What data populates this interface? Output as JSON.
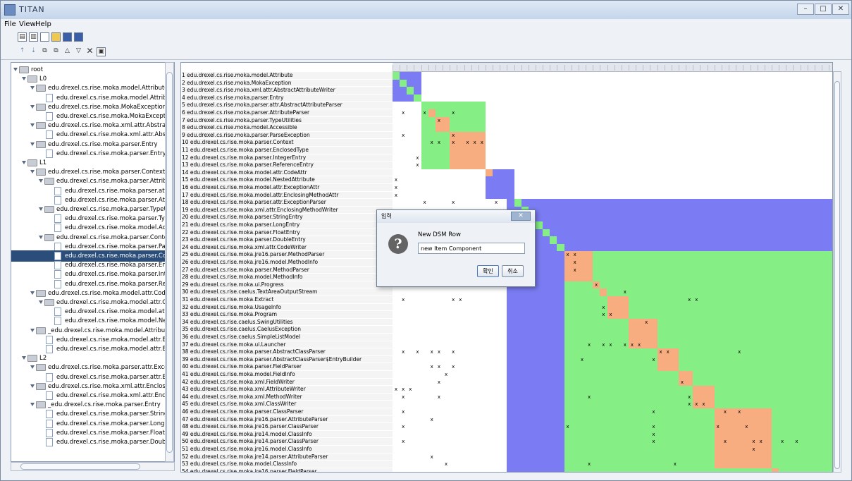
{
  "window": {
    "title": "TITAN",
    "controls": [
      "–",
      "□",
      "✕"
    ]
  },
  "menu": [
    "File",
    "View",
    "Help"
  ],
  "colors": {
    "blue": "#7b7cf3",
    "green": "#85ee84",
    "orange": "#f7ad80",
    "selected": "#2a4d79"
  },
  "tree": [
    {
      "label": "root",
      "kind": "folder",
      "depth": 0,
      "expanded": true
    },
    {
      "label": "L0",
      "kind": "folder",
      "depth": 1,
      "expanded": true
    },
    {
      "label": "edu.drexel.cs.rise.moka.model.Attribute",
      "kind": "folder",
      "depth": 2,
      "expanded": true
    },
    {
      "label": "edu.drexel.cs.rise.moka.model.Attribute",
      "kind": "file",
      "depth": 3
    },
    {
      "label": "edu.drexel.cs.rise.moka.MokaException",
      "kind": "folder",
      "depth": 2,
      "expanded": true
    },
    {
      "label": "edu.drexel.cs.rise.moka.MokaException",
      "kind": "file",
      "depth": 3
    },
    {
      "label": "edu.drexel.cs.rise.moka.xml.attr.AbstractAttribute",
      "kind": "folder",
      "depth": 2,
      "expanded": true
    },
    {
      "label": "edu.drexel.cs.rise.moka.xml.attr.AbstractAttrib",
      "kind": "file",
      "depth": 3
    },
    {
      "label": "edu.drexel.cs.rise.moka.parser.Entry",
      "kind": "folder",
      "depth": 2,
      "expanded": true
    },
    {
      "label": "edu.drexel.cs.rise.moka.parser.Entry",
      "kind": "file",
      "depth": 3
    },
    {
      "label": "L1",
      "kind": "folder",
      "depth": 1,
      "expanded": true
    },
    {
      "label": "edu.drexel.cs.rise.moka.parser.Context",
      "kind": "folder",
      "depth": 2,
      "expanded": true
    },
    {
      "label": "edu.drexel.cs.rise.moka.parser.AttributeParse",
      "kind": "folder",
      "depth": 3,
      "expanded": true
    },
    {
      "label": "edu.drexel.cs.rise.moka.parser.attr.Abstra",
      "kind": "file",
      "depth": 4
    },
    {
      "label": "edu.drexel.cs.rise.moka.parser.AttributePa",
      "kind": "file",
      "depth": 4
    },
    {
      "label": "edu.drexel.cs.rise.moka.parser.TypeUtilities",
      "kind": "folder",
      "depth": 3,
      "expanded": true
    },
    {
      "label": "edu.drexel.cs.rise.moka.parser.TypeUtilitie",
      "kind": "file",
      "depth": 4
    },
    {
      "label": "edu.drexel.cs.rise.moka.model.Accessible",
      "kind": "file",
      "depth": 4
    },
    {
      "label": "edu.drexel.cs.rise.moka.parser.Context",
      "kind": "folder",
      "depth": 3,
      "expanded": true
    },
    {
      "label": "edu.drexel.cs.rise.moka.parser.ParseExce",
      "kind": "file",
      "depth": 4
    },
    {
      "label": "edu.drexel.cs.rise.moka.parser.Context",
      "kind": "file",
      "depth": 4,
      "selected": true
    },
    {
      "label": "edu.drexel.cs.rise.moka.parser.EnclosedT",
      "kind": "file",
      "depth": 4
    },
    {
      "label": "edu.drexel.cs.rise.moka.parser.IntegerEnt",
      "kind": "file",
      "depth": 4
    },
    {
      "label": "edu.drexel.cs.rise.moka.parser.Reference",
      "kind": "file",
      "depth": 4
    },
    {
      "label": "edu.drexel.cs.rise.moka.model.attr.CodeAttr",
      "kind": "folder",
      "depth": 2,
      "expanded": true
    },
    {
      "label": "edu.drexel.cs.rise.moka.model.attr.CodeAttr",
      "kind": "folder",
      "depth": 3,
      "expanded": true
    },
    {
      "label": "edu.drexel.cs.rise.moka.model.attr.CodeA",
      "kind": "file",
      "depth": 4
    },
    {
      "label": "edu.drexel.cs.rise.moka.model.NestedAttr",
      "kind": "file",
      "depth": 4
    },
    {
      "label": "_edu.drexel.cs.rise.moka.model.Attribute",
      "kind": "folder",
      "depth": 2,
      "expanded": true
    },
    {
      "label": "edu.drexel.cs.rise.moka.model.attr.Exception",
      "kind": "file",
      "depth": 3
    },
    {
      "label": "edu.drexel.cs.rise.moka.model.attr.Enclosing",
      "kind": "file",
      "depth": 3
    },
    {
      "label": "L2",
      "kind": "folder",
      "depth": 1,
      "expanded": true
    },
    {
      "label": "edu.drexel.cs.rise.moka.parser.attr.ExceptionPa",
      "kind": "folder",
      "depth": 2,
      "expanded": true
    },
    {
      "label": "edu.drexel.cs.rise.moka.parser.attr.Exception",
      "kind": "file",
      "depth": 3
    },
    {
      "label": "edu.drexel.cs.rise.moka.xml.attr.EnclosingMetho",
      "kind": "folder",
      "depth": 2,
      "expanded": true
    },
    {
      "label": "edu.drexel.cs.rise.moka.xml.attr.EnclosingMe",
      "kind": "file",
      "depth": 3
    },
    {
      "label": "_edu.drexel.cs.rise.moka.parser.Entry",
      "kind": "folder",
      "depth": 2,
      "expanded": true
    },
    {
      "label": "edu.drexel.cs.rise.moka.parser.StringEntry",
      "kind": "file",
      "depth": 3
    },
    {
      "label": "edu.drexel.cs.rise.moka.parser.LongEntry",
      "kind": "file",
      "depth": 3
    },
    {
      "label": "edu.drexel.cs.rise.moka.parser.FloatEntry",
      "kind": "file",
      "depth": 3
    },
    {
      "label": "edu.drexel.cs.rise.moka.parser.DoubleEntry",
      "kind": "file",
      "depth": 3
    }
  ],
  "dsm_rows": [
    "1 edu.drexel.cs.rise.moka.model.Attribute",
    "2 edu.drexel.cs.rise.moka.MokaException",
    "3 edu.drexel.cs.rise.moka.xml.attr.AbstractAttributeWriter",
    "4 edu.drexel.cs.rise.moka.parser.Entry",
    "5 edu.drexel.cs.rise.moka.parser.attr.AbstractAttributeParser",
    "6 edu.drexel.cs.rise.moka.parser.AttributeParser",
    "7 edu.drexel.cs.rise.moka.parser.TypeUtilities",
    "8 edu.drexel.cs.rise.moka.model.Accessible",
    "9 edu.drexel.cs.rise.moka.parser.ParseException",
    "10 edu.drexel.cs.rise.moka.parser.Context",
    "11 edu.drexel.cs.rise.moka.parser.EnclosedType",
    "12 edu.drexel.cs.rise.moka.parser.IntegerEntry",
    "13 edu.drexel.cs.rise.moka.parser.ReferenceEntry",
    "14 edu.drexel.cs.rise.moka.model.attr.CodeAttr",
    "15 edu.drexel.cs.rise.moka.model.NestedAttribute",
    "16 edu.drexel.cs.rise.moka.model.attr.ExceptionAttr",
    "17 edu.drexel.cs.rise.moka.model.attr.EnclosingMethodAttr",
    "18 edu.drexel.cs.rise.moka.parser.attr.ExceptionParser",
    "19 edu.drexel.cs.rise.moka.xml.attr.EnclosingMethodWriter",
    "20 edu.drexel.cs.rise.moka.parser.StringEntry",
    "21 edu.drexel.cs.rise.moka.parser.LongEntry",
    "22 edu.drexel.cs.rise.moka.parser.FloatEntry",
    "23 edu.drexel.cs.rise.moka.parser.DoubleEntry",
    "24 edu.drexel.cs.rise.moka.xml.attr.CodeWriter",
    "25 edu.drexel.cs.rise.moka.jre16.parser.MethodParser",
    "26 edu.drexel.cs.rise.moka.jre16.model.MethodInfo",
    "27 edu.drexel.cs.rise.moka.parser.MethodParser",
    "28 edu.drexel.cs.rise.moka.model.MethodInfo",
    "29 edu.drexel.cs.rise.moka.ui.Progress",
    "30 edu.drexel.cs.rise.caelus.TextAreaOutputStream",
    "31 edu.drexel.cs.rise.moka.Extract",
    "32 edu.drexel.cs.rise.moka.UsageInfo",
    "33 edu.drexel.cs.rise.moka.Program",
    "34 edu.drexel.cs.rise.caelus.SwingUtilities",
    "35 edu.drexel.cs.rise.caelus.CaelusException",
    "36 edu.drexel.cs.rise.caelus.SimpleListModel",
    "37 edu.drexel.cs.rise.moka.ui.Launcher",
    "38 edu.drexel.cs.rise.moka.parser.AbstractClassParser",
    "39 edu.drexel.cs.rise.moka.parser.AbstractClassParser$EntryBuilder",
    "40 edu.drexel.cs.rise.moka.parser.FieldParser",
    "41 edu.drexel.cs.rise.moka.model.FieldInfo",
    "42 edu.drexel.cs.rise.moka.xml.FieldWriter",
    "43 edu.drexel.cs.rise.moka.xml.AttributeWriter",
    "44 edu.drexel.cs.rise.moka.xml.MethodWriter",
    "45 edu.drexel.cs.rise.moka.xml.ClassWriter",
    "46 edu.drexel.cs.rise.moka.parser.ClassParser",
    "47 edu.drexel.cs.rise.moka.jre16.parser.AttributeParser",
    "48 edu.drexel.cs.rise.moka.jre16.parser.ClassParser",
    "49 edu.drexel.cs.rise.moka.jre14.model.ClassInfo",
    "50 edu.drexel.cs.rise.moka.jre14.parser.ClassParser",
    "51 edu.drexel.cs.rise.moka.jre16.model.ClassInfo",
    "52 edu.drexel.cs.rise.moka.jre14.parser.AttributeParser",
    "53 edu.drexel.cs.rise.moka.model.ClassInfo",
    "54 edu.drexel.cs.rise.moka.jre16.parser.FieldParser"
  ],
  "dsm_blocks": [
    {
      "from": 1,
      "to": 4,
      "color": "blue"
    },
    {
      "from": 5,
      "to": 13,
      "color": "green"
    },
    {
      "from": 14,
      "to": 17,
      "color": "blue"
    },
    {
      "from": 18,
      "to": 24,
      "color": "green"
    },
    {
      "from": 25,
      "to": 54,
      "color": "green"
    }
  ],
  "dsm_orange_blocks": [
    {
      "from": 6,
      "to": 6
    },
    {
      "from": 7,
      "to": 8
    },
    {
      "from": 9,
      "to": 13
    },
    {
      "from": 14,
      "to": 14
    },
    {
      "from": 25,
      "to": 28
    },
    {
      "from": 29,
      "to": 29
    },
    {
      "from": 30,
      "to": 30
    },
    {
      "from": 31,
      "to": 33
    },
    {
      "from": 34,
      "to": 37
    },
    {
      "from": 38,
      "to": 40
    },
    {
      "from": 41,
      "to": 42
    },
    {
      "from": 43,
      "to": 45
    },
    {
      "from": 46,
      "to": 53
    },
    {
      "from": 54,
      "to": 54
    }
  ],
  "dsm_diagonal_green": [
    1,
    2,
    3,
    4,
    18,
    19,
    20,
    21,
    22,
    23,
    24
  ],
  "dsm_marks": [
    [
      6,
      2
    ],
    [
      6,
      5
    ],
    [
      6,
      9
    ],
    [
      7,
      7
    ],
    [
      9,
      2
    ],
    [
      9,
      9
    ],
    [
      10,
      6
    ],
    [
      10,
      7
    ],
    [
      10,
      9
    ],
    [
      10,
      11
    ],
    [
      10,
      12
    ],
    [
      10,
      13
    ],
    [
      12,
      4
    ],
    [
      13,
      4
    ],
    [
      15,
      1
    ],
    [
      16,
      1
    ],
    [
      17,
      1
    ],
    [
      18,
      5
    ],
    [
      18,
      9
    ],
    [
      18,
      15
    ],
    [
      25,
      25
    ],
    [
      25,
      26
    ],
    [
      26,
      26
    ],
    [
      27,
      26
    ],
    [
      29,
      29
    ],
    [
      30,
      33
    ],
    [
      31,
      2
    ],
    [
      31,
      9
    ],
    [
      31,
      10
    ],
    [
      31,
      42
    ],
    [
      31,
      43
    ],
    [
      32,
      30
    ],
    [
      33,
      30
    ],
    [
      33,
      31
    ],
    [
      34,
      36
    ],
    [
      37,
      28
    ],
    [
      37,
      30
    ],
    [
      37,
      31
    ],
    [
      37,
      33
    ],
    [
      37,
      34
    ],
    [
      37,
      35
    ],
    [
      38,
      2
    ],
    [
      38,
      4
    ],
    [
      38,
      6
    ],
    [
      38,
      7
    ],
    [
      38,
      9
    ],
    [
      38,
      38
    ],
    [
      38,
      39
    ],
    [
      38,
      49
    ],
    [
      39,
      27
    ],
    [
      39,
      37
    ],
    [
      40,
      6
    ],
    [
      40,
      7
    ],
    [
      40,
      9
    ],
    [
      41,
      8
    ],
    [
      42,
      7
    ],
    [
      42,
      41
    ],
    [
      43,
      1
    ],
    [
      43,
      2
    ],
    [
      43,
      3
    ],
    [
      44,
      2
    ],
    [
      44,
      7
    ],
    [
      44,
      28
    ],
    [
      44,
      42
    ],
    [
      45,
      42
    ],
    [
      45,
      43
    ],
    [
      45,
      44
    ],
    [
      46,
      2
    ],
    [
      46,
      37
    ],
    [
      46,
      47
    ],
    [
      46,
      49
    ],
    [
      47,
      6
    ],
    [
      48,
      2
    ],
    [
      48,
      25
    ],
    [
      48,
      37
    ],
    [
      48,
      46
    ],
    [
      48,
      50
    ],
    [
      49,
      37
    ],
    [
      50,
      2
    ],
    [
      50,
      37
    ],
    [
      50,
      47
    ],
    [
      50,
      51
    ],
    [
      50,
      52
    ],
    [
      50,
      55
    ],
    [
      50,
      57
    ],
    [
      51,
      51
    ],
    [
      52,
      6
    ],
    [
      53,
      8
    ],
    [
      53,
      28
    ],
    [
      53,
      40
    ]
  ],
  "dialog": {
    "title": "입력",
    "message": "New DSM Row",
    "input_value": "new Item Component",
    "ok": "확인",
    "cancel": "취소",
    "close": "✕"
  }
}
